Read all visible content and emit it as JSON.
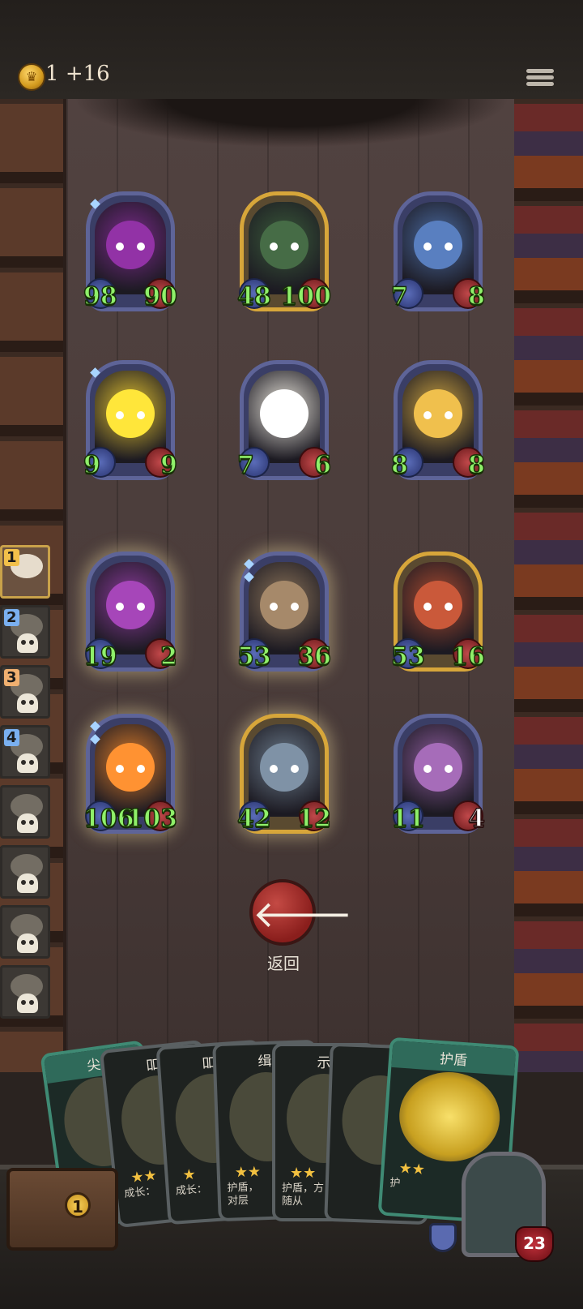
{
  "header": {
    "coins": "1",
    "coin_income": "+16"
  },
  "minions": [
    {
      "attack": "98",
      "health": "90",
      "frame": "blue",
      "portrait_color": "#7a2a8a",
      "marks": 1
    },
    {
      "attack": "48",
      "health": "100",
      "frame": "gold",
      "portrait_color": "#3a5a3a",
      "marks": 0
    },
    {
      "attack": "7",
      "health": "8",
      "frame": "blue",
      "portrait_color": "#4a6aa0",
      "marks": 0
    },
    {
      "attack": "9",
      "health": "9",
      "frame": "blue",
      "portrait_color": "#e0c030",
      "marks": 1
    },
    {
      "attack": "7",
      "health": "6",
      "frame": "blue",
      "portrait_color": "#eae6dc",
      "marks": 0
    },
    {
      "attack": "8",
      "health": "8",
      "frame": "blue",
      "portrait_color": "#c8a040",
      "marks": 0
    },
    {
      "attack": "19",
      "health": "2",
      "frame": "blue",
      "portrait_color": "#8a3a9a",
      "marks": 0
    },
    {
      "attack": "53",
      "health": "36",
      "frame": "blue",
      "portrait_color": "#8a7258",
      "marks": 2
    },
    {
      "attack": "53",
      "health": "16",
      "frame": "gold",
      "portrait_color": "#a84a30",
      "marks": 0
    },
    {
      "attack": "106",
      "health": "103",
      "frame": "blue",
      "portrait_color": "#d87a2a",
      "marks": 2
    },
    {
      "attack": "42",
      "health": "12",
      "frame": "gold",
      "portrait_color": "#6a7a8a",
      "marks": 0
    },
    {
      "attack": "11",
      "health": "4",
      "frame": "blue",
      "portrait_color": "#8a5a9a",
      "marks": 0
    }
  ],
  "queue": [
    {
      "rank": "1",
      "state": "active"
    },
    {
      "rank": "2",
      "state": "dead"
    },
    {
      "rank": "3",
      "state": "dead"
    },
    {
      "rank": "4",
      "state": "dead"
    },
    {
      "rank": "",
      "state": "dead"
    },
    {
      "rank": "",
      "state": "dead"
    },
    {
      "rank": "",
      "state": "dead"
    },
    {
      "rank": "",
      "state": "dead"
    }
  ],
  "back_button": {
    "label": "返回"
  },
  "hand": [
    {
      "title": "尖",
      "stars": "",
      "desc": ""
    },
    {
      "title": "吅",
      "stars": "★★",
      "desc": "成长："
    },
    {
      "title": "吅",
      "stars": "★",
      "desc": "成长："
    },
    {
      "title": "缉",
      "stars": "★★",
      "desc": "护盾，\n对层"
    },
    {
      "title": "示",
      "stars": "★★",
      "desc": "护盾，方\n随从"
    },
    {
      "title": "",
      "stars": "",
      "desc": ""
    },
    {
      "title": "护盾",
      "stars": "★★",
      "desc": "护"
    }
  ],
  "chest": {
    "count": "1"
  },
  "hero": {
    "health": "23"
  }
}
